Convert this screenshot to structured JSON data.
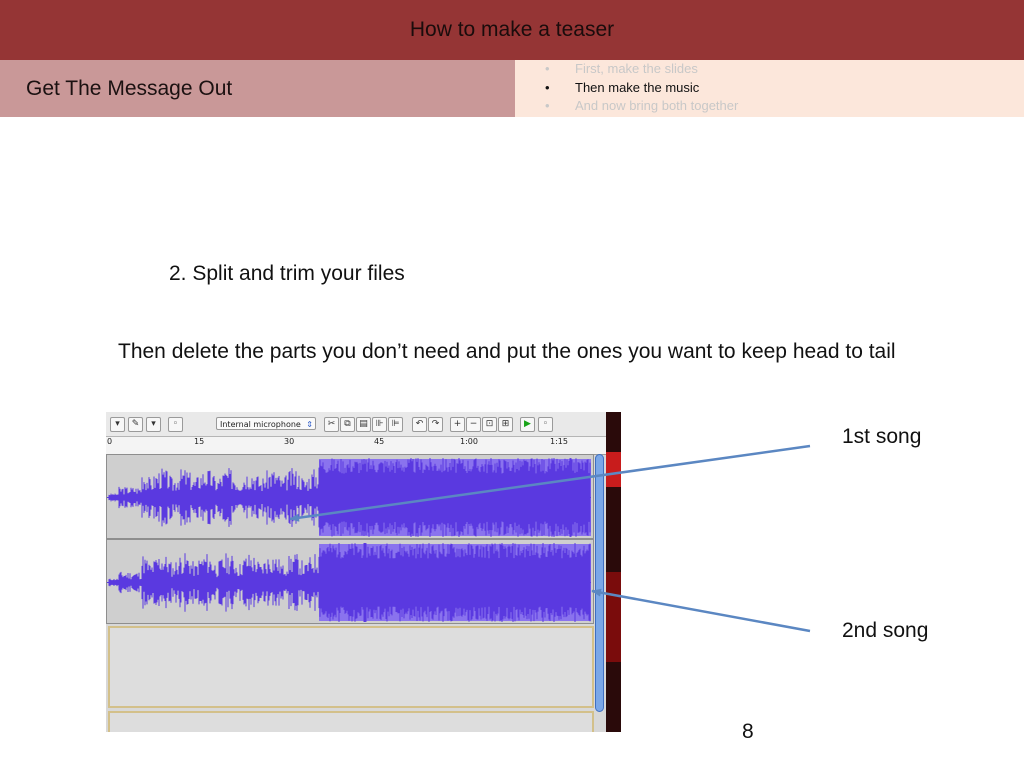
{
  "header": {
    "title": "How to make a teaser"
  },
  "section": {
    "title": "Get The Message Out"
  },
  "progress": {
    "items": [
      {
        "label": "First, make the slides",
        "active": false
      },
      {
        "label": "Then make the music",
        "active": true
      },
      {
        "label": "And now bring both together",
        "active": false
      }
    ]
  },
  "content": {
    "step": "2. Split and trim your files",
    "description": "Then delete the parts you don’t need and put the ones you want to keep head to tail",
    "label_first": "1st song",
    "label_second": "2nd song",
    "page_number": "8"
  },
  "screenshot": {
    "input_device": "Internal microphone",
    "ruler_ticks": [
      "0",
      "15",
      "30",
      "45",
      "1:00",
      "1:15"
    ],
    "waveform_color": "#5a39e0",
    "waveform_highlight": "#8a73ee"
  },
  "colors": {
    "title_bar": "#953535",
    "section_bar": "#c99898",
    "progress_panel": "#fce7db",
    "arrow": "#5b87c2"
  }
}
